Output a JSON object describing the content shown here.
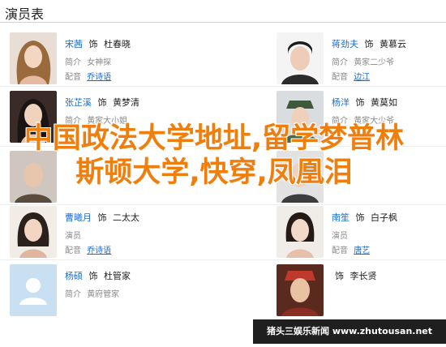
{
  "page_title": "演员表",
  "labels": {
    "role_prefix": "饰",
    "actor_suffix": "演员",
    "voice_prefix": "简介",
    "dub_prefix": "配音"
  },
  "cast": [
    {
      "actor": "宋茜",
      "role": "杜春晓",
      "voice": "女神探",
      "dub": "乔诗语"
    },
    {
      "actor": "蒋劲夫",
      "role": "黄慕云",
      "voice": "黄家二少爷",
      "dub": "边江"
    },
    {
      "actor": "张芷溪",
      "role": "黄梦清",
      "voice": "黄家大小姐",
      "dub": ""
    },
    {
      "actor": "杨洋",
      "role": "黄莫如",
      "voice": "黄家大少爷",
      "dub": ""
    },
    {
      "actor": "",
      "role": "",
      "voice": "",
      "dub": ""
    },
    {
      "actor": "",
      "role": "",
      "voice": "",
      "dub": ""
    },
    {
      "actor": "曹曦月",
      "role": "二太太",
      "voice": "",
      "dub": "乔诗语"
    },
    {
      "actor": "南笙",
      "role": "白子枫",
      "voice": "",
      "dub": "唐艺"
    },
    {
      "actor": "杨硕",
      "role": "杜管家",
      "voice": "黄府管家",
      "dub": ""
    },
    {
      "actor": "",
      "role": "李长贤",
      "voice": "",
      "dub": ""
    }
  ],
  "overlay_text": "中国政法大学地址,留学梦普林斯顿大学,快穿,凤凰泪",
  "watermark": "猪头三娱乐新闻 www.zhutousan.net",
  "colors": {
    "link": "#1a6bd1",
    "overlay": "#f07e0d"
  }
}
